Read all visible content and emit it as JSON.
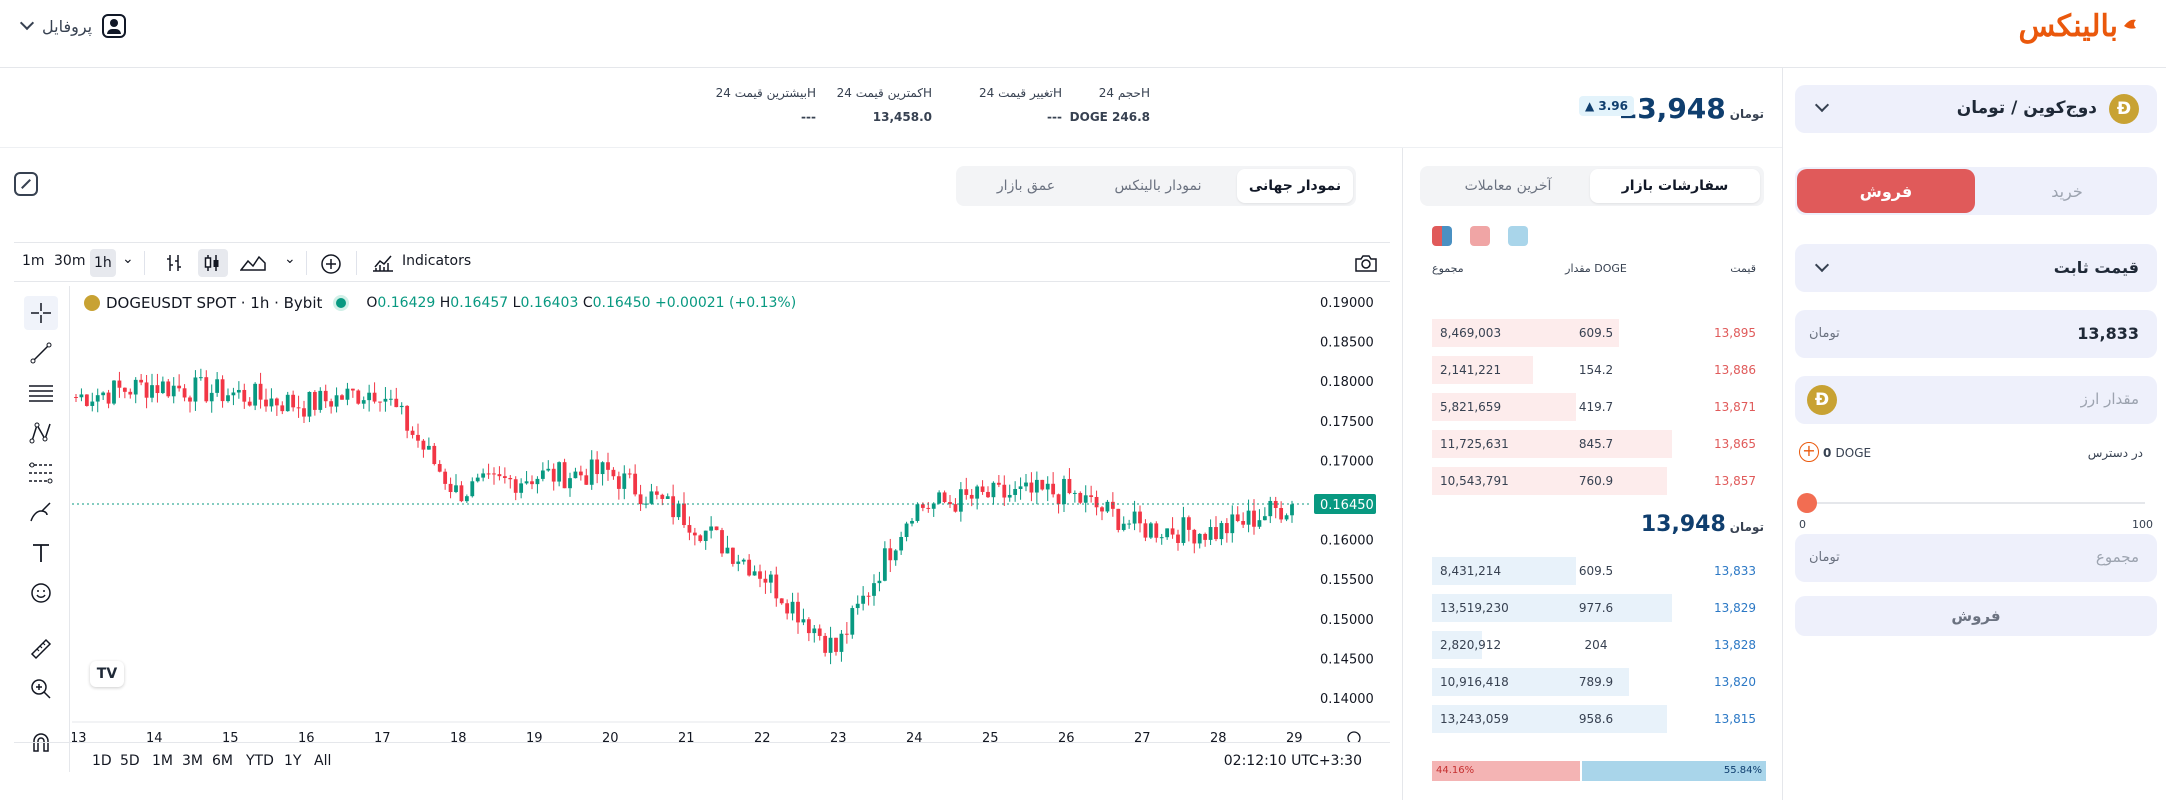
{
  "header": {
    "logo": "بالینکس",
    "profile_label": "پروفایل"
  },
  "stats": {
    "price": "13,948",
    "currency": "تومان",
    "change": "▲ 3.96",
    "volume_label": "حجم 24H",
    "volume_value": "DOGE 246.8",
    "change_label": "تغییر قیمت 24H",
    "change_value": "---",
    "low_label": "کمترین قیمت 24H",
    "low_value": "13,458.0",
    "high_label": "بیشترین قیمت 24H",
    "high_value": "---"
  },
  "chart_tabs": [
    "نمودار جهانی",
    "نمودار بالینکس",
    "عمق بازار"
  ],
  "toolbar": {
    "intervals": [
      "1m",
      "30m",
      "1h"
    ],
    "indicators": "Indicators"
  },
  "legend": {
    "symbol": "DOGEUSDT SPOT · 1h · Bybit",
    "o_label": "O",
    "o": "0.16429",
    "h_label": "H",
    "h": "0.16457",
    "l_label": "L",
    "l": "0.16403",
    "c_label": "C",
    "c": "0.16450",
    "chg": "+0.00021 (+0.13%)"
  },
  "ranges": [
    "1D",
    "5D",
    "1M",
    "3M",
    "6M",
    "YTD",
    "1Y",
    "All"
  ],
  "clock": "02:12:10 UTC+3:30",
  "chart_data": {
    "type": "line",
    "x": [
      "13",
      "14",
      "15",
      "16",
      "17",
      "18",
      "19",
      "20",
      "21",
      "22",
      "23",
      "24",
      "25",
      "26",
      "27",
      "28",
      "29"
    ],
    "y": [
      0.178,
      0.1795,
      0.1785,
      0.177,
      0.179,
      0.166,
      0.168,
      0.1685,
      0.163,
      0.156,
      0.146,
      0.164,
      0.1655,
      0.166,
      0.1615,
      0.161,
      0.1645
    ],
    "ylim": [
      0.139,
      0.191
    ],
    "y_ticks": [
      "0.19000",
      "0.18500",
      "0.18000",
      "0.17500",
      "0.17000",
      "0.16500",
      "0.16000",
      "0.15500",
      "0.15000",
      "0.14500",
      "0.14000"
    ],
    "last_price": "0.16450",
    "up_color": "#089981",
    "down_color": "#f23645"
  },
  "orderbook": {
    "tabs": [
      "سفارشات بازار",
      "آخرین معاملات"
    ],
    "col_price": "قیمت",
    "col_amount": "مقدار DOGE",
    "col_total": "مجموع",
    "asks": [
      {
        "price": "13,895",
        "amount": "609.5",
        "total": "8,469,003",
        "depth": 0.78
      },
      {
        "price": "13,886",
        "amount": "154.2",
        "total": "2,141,221",
        "depth": 0.42
      },
      {
        "price": "13,871",
        "amount": "419.7",
        "total": "5,821,659",
        "depth": 0.6
      },
      {
        "price": "13,865",
        "amount": "845.7",
        "total": "11,725,631",
        "depth": 1.0
      },
      {
        "price": "13,857",
        "amount": "760.9",
        "total": "10,543,791",
        "depth": 0.98
      }
    ],
    "mid_price": "13,948",
    "bids": [
      {
        "price": "13,833",
        "amount": "609.5",
        "total": "8,431,214",
        "depth": 0.6
      },
      {
        "price": "13,829",
        "amount": "977.6",
        "total": "13,519,230",
        "depth": 1.0
      },
      {
        "price": "13,828",
        "amount": "204",
        "total": "2,820,912",
        "depth": 0.21
      },
      {
        "price": "13,820",
        "amount": "789.9",
        "total": "10,916,418",
        "depth": 0.82
      },
      {
        "price": "13,815",
        "amount": "958.6",
        "total": "13,243,059",
        "depth": 0.98
      }
    ],
    "sell_ratio": "44.16%",
    "buy_ratio": "55.84%"
  },
  "trade": {
    "pair": "دوج‌کوین / تومان",
    "buy_tab": "خرید",
    "sell_tab": "فروش",
    "order_type": "قیمت ثابت",
    "price_value": "13,833",
    "amount_placeholder": "مقدار ارز",
    "available_label": "در دسترس",
    "available_value": "0",
    "available_unit": "DOGE",
    "slider_min": "0",
    "slider_max": "100",
    "total_placeholder": "مجموع",
    "submit": "فروش"
  }
}
